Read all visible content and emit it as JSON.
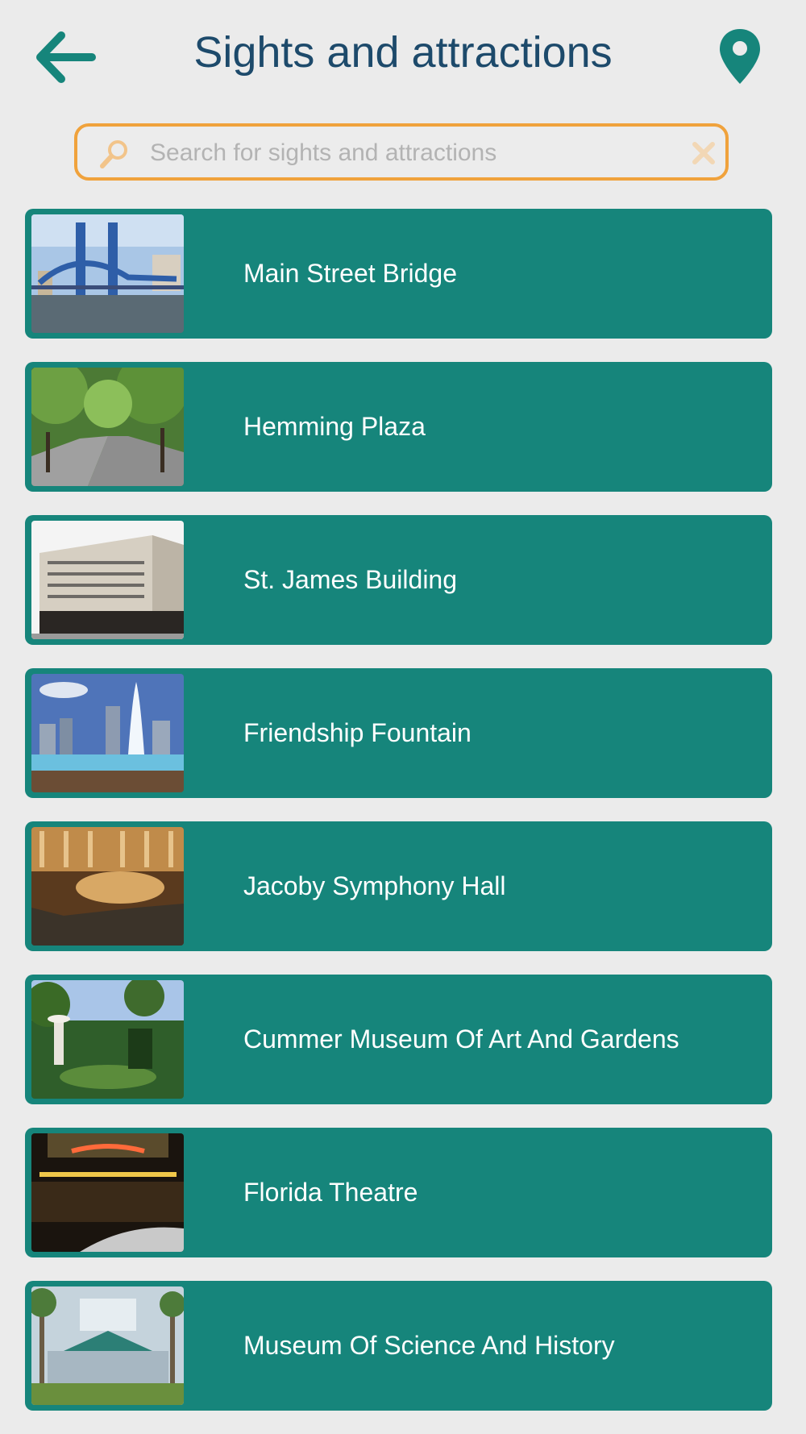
{
  "header": {
    "title": "Sights and attractions",
    "back_icon": "arrow-left-icon",
    "location_icon": "map-pin-icon"
  },
  "search": {
    "placeholder": "Search for sights and attractions",
    "value": "",
    "search_icon": "magnifier-icon",
    "clear_icon": "close-icon"
  },
  "colors": {
    "background": "#ebebeb",
    "accent": "#16857b",
    "title": "#1d4a6b",
    "search_border": "#f0a23c"
  },
  "items": [
    {
      "label": "Main Street Bridge"
    },
    {
      "label": "Hemming Plaza"
    },
    {
      "label": "St. James Building"
    },
    {
      "label": "Friendship Fountain"
    },
    {
      "label": "Jacoby Symphony Hall"
    },
    {
      "label": "Cummer Museum Of Art And Gardens"
    },
    {
      "label": "Florida Theatre"
    },
    {
      "label": "Museum Of Science And History"
    }
  ]
}
